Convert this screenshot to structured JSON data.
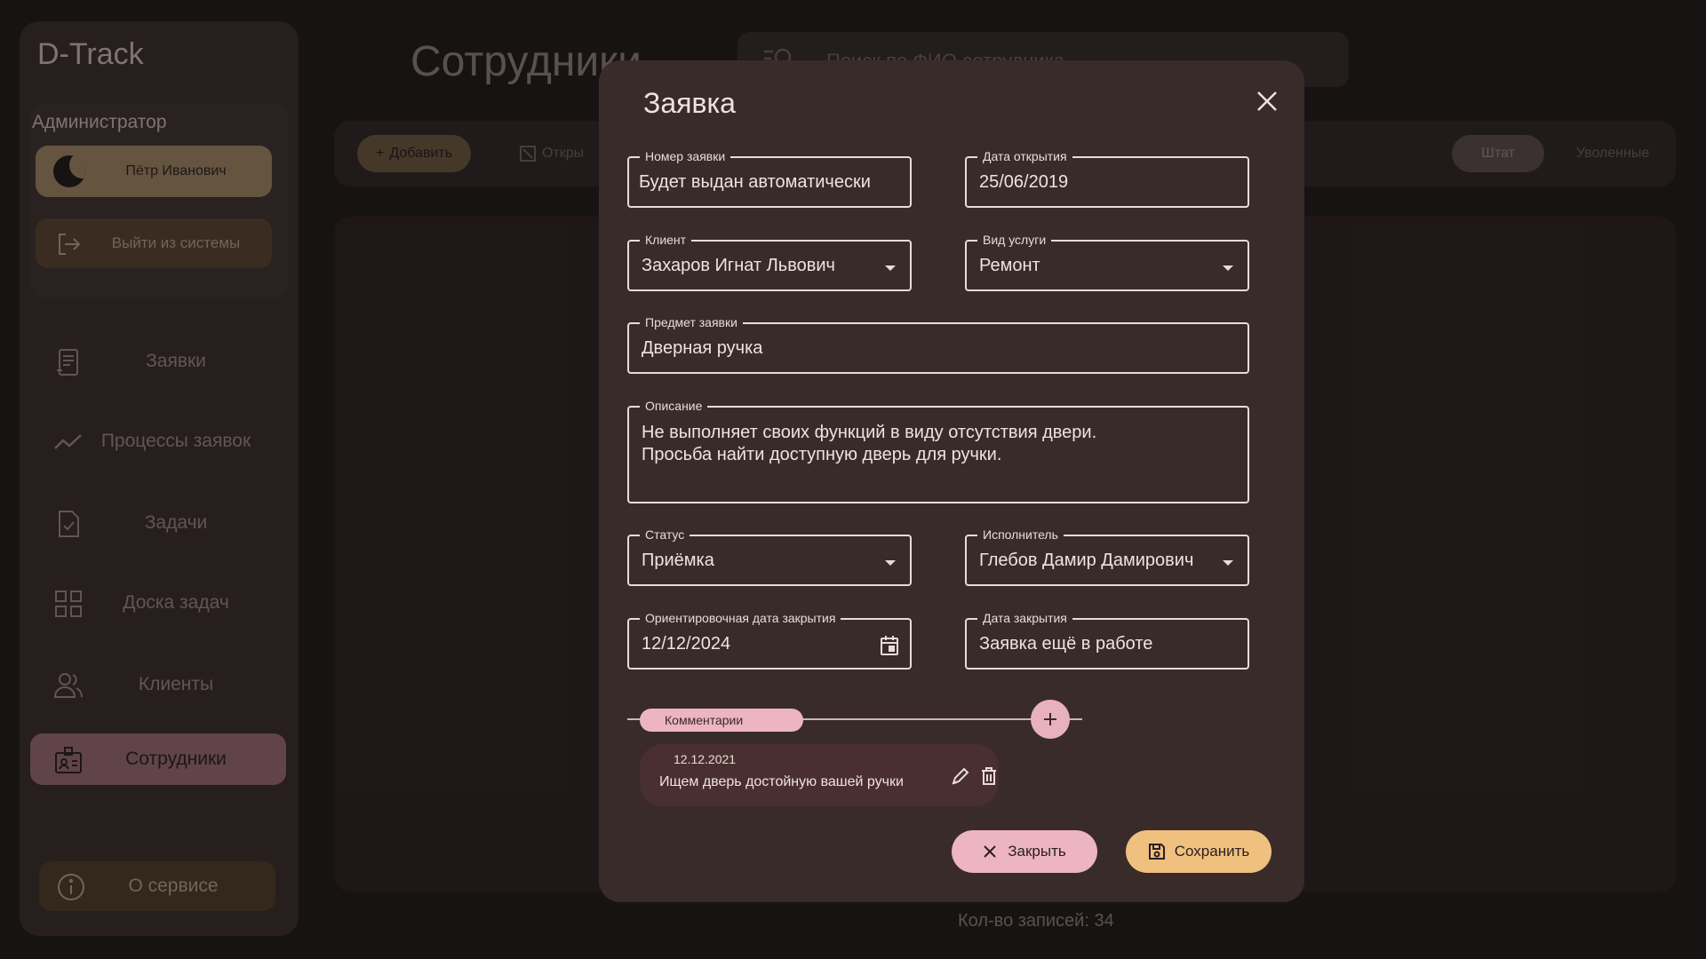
{
  "app": {
    "logo": "D-Track"
  },
  "sidebar": {
    "role": "Администратор",
    "user_name": "Пётр Иванович",
    "logout": "Выйти из системы",
    "items": [
      {
        "label": "Заявки",
        "icon": "document-icon"
      },
      {
        "label": "Процессы заявок",
        "icon": "trend-icon"
      },
      {
        "label": "Задачи",
        "icon": "task-check-icon"
      },
      {
        "label": "Доска задач",
        "icon": "grid-icon"
      },
      {
        "label": "Клиенты",
        "icon": "people-icon"
      },
      {
        "label": "Сотрудники",
        "icon": "badge-icon",
        "active": true
      }
    ],
    "about": "О сервисе"
  },
  "page": {
    "title": "Сотрудники",
    "search_placeholder": "Поиск по ФИО сотрудника",
    "toolbar": {
      "add": "Добавить",
      "open": "Откры"
    },
    "tabs": [
      "Штат",
      "Уволенные"
    ],
    "records": "Кол-во записей: 34"
  },
  "modal": {
    "title": "Заявка",
    "fields": {
      "number": {
        "label": "Номер заявки",
        "value": "Будет выдан автоматически"
      },
      "open_date": {
        "label": "Дата открытия",
        "value": "25/06/2019"
      },
      "client": {
        "label": "Клиент",
        "value": "Захаров Игнат Львович"
      },
      "service": {
        "label": "Вид услуги",
        "value": "Ремонт"
      },
      "subject": {
        "label": "Предмет заявки",
        "value": "Дверная ручка"
      },
      "description": {
        "label": "Описание",
        "line1": "Не выполняет своих функций в виду отсутствия двери.",
        "line2": "Просьба найти доступную дверь для ручки."
      },
      "status": {
        "label": "Статус",
        "value": "Приёмка"
      },
      "assignee": {
        "label": "Исполнитель",
        "value": "Глебов Дамир Дамирович"
      },
      "est_close": {
        "label": "Ориентировочная дата закрытия",
        "value": "12/12/2024"
      },
      "close_date": {
        "label": "Дата закрытия",
        "value": "Заявка ещё в работе"
      }
    },
    "comments": {
      "label": "Комментарии",
      "items": [
        {
          "date": "12.12.2021",
          "text": "Ищем дверь достойную вашей ручки"
        }
      ]
    },
    "buttons": {
      "close": "Закрыть",
      "save": "Сохранить"
    }
  },
  "colors": {
    "background": "#1f1a1a",
    "modal": "#3a2b2b",
    "accent_pink": "#ecb5c0",
    "accent_gold": "#f0c07e"
  }
}
